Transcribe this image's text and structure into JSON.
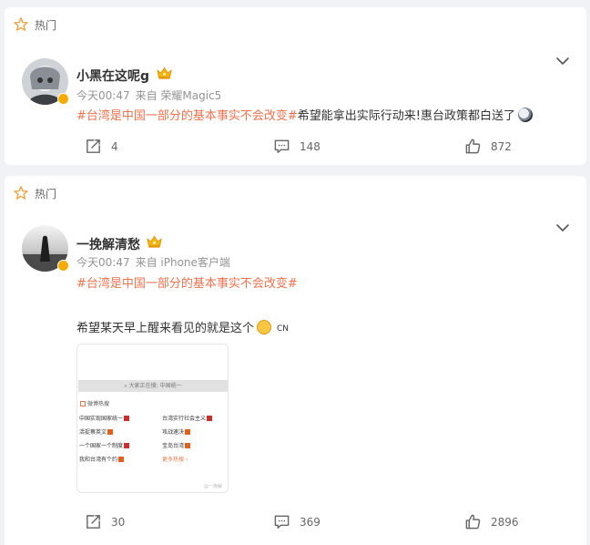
{
  "posts": [
    {
      "hot_label": "热门",
      "username": "小黑在这呢g",
      "time": "今天00:47",
      "source": "来自 荣耀Magic5",
      "hashtag": "#台湾是中国一部分的基本事实不会改变#",
      "text": "希望能拿出实际行动来!惠台政策都白送了",
      "repost_count": "4",
      "comment_count": "148",
      "like_count": "872"
    },
    {
      "hot_label": "热门",
      "username": "一挽解清愁",
      "time": "今天00:47",
      "source": "来自 iPhone客户端",
      "hashtag": "#台湾是中国一部分的基本事实不会改变#",
      "text": "希望某天早上醒来看见的就是这个",
      "text_suffix": "CN",
      "image": {
        "search_text": "大家正在搜: 中国统一",
        "header": "微博热搜",
        "items_left": [
          "中国实现国家统一",
          "活捉蔡英文",
          "一个国家一个制度",
          "我和台湾有个约"
        ],
        "items_right": [
          "台湾实行社会主义",
          "攻战速决",
          "宝岛台湾",
          "更多热搜"
        ],
        "watermark": "@一挽解"
      },
      "repost_count": "30",
      "comment_count": "369",
      "like_count": "2896"
    }
  ],
  "colors": {
    "accent": "#eb7350",
    "vip": "#f6ab00"
  },
  "icons": [
    "star-icon",
    "chevron-down-icon",
    "verified-badge-icon",
    "crown-icon",
    "repost-icon",
    "comment-icon",
    "like-icon"
  ]
}
